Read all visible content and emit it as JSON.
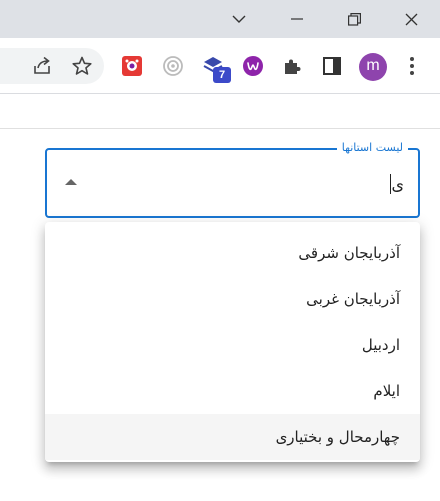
{
  "window_controls": {
    "icons": [
      "chevron-down-icon",
      "minimize-icon",
      "restore-icon",
      "close-icon"
    ]
  },
  "toolbar": {
    "icons": [
      "share-icon",
      "bookmark-star-icon",
      "extension-red-icon",
      "extension-circle-icon",
      "extension-stack-icon",
      "extension-w-icon",
      "puzzle-icon",
      "side-panel-icon",
      "more-vert-icon"
    ],
    "extension_badge": "7",
    "avatar_letter": "m",
    "avatar_color": "#8e44ad"
  },
  "autocomplete": {
    "label": "لیست استانها",
    "value": "ی",
    "accent_color": "#1976d2",
    "options": [
      {
        "label": "آذربایجان شرقی"
      },
      {
        "label": "آذربایجان غربی"
      },
      {
        "label": "اردبیل"
      },
      {
        "label": "ایلام"
      },
      {
        "label": "چهارمحال و بختیاری"
      }
    ],
    "highlighted_index": 4
  }
}
